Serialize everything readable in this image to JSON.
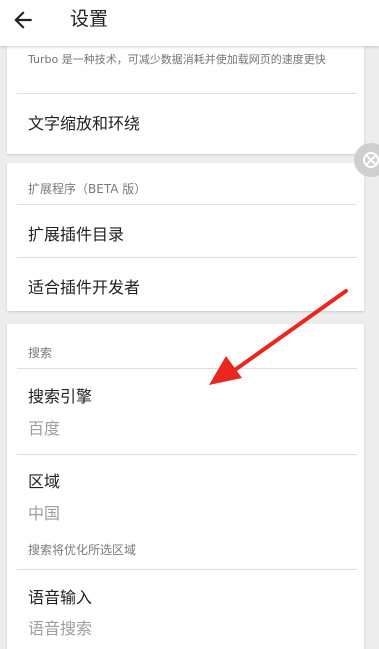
{
  "header": {
    "title": "设置",
    "back_icon": "arrow-left-icon"
  },
  "turbo_card": {
    "description": "Turbo 是一种技术，可减少数据消耗并使加载网页的速度更快",
    "text_scaling_label": "文字缩放和环绕"
  },
  "extensions_card": {
    "section_title": "扩展程序（BETA 版）",
    "catalog_label": "扩展插件目录",
    "developer_label": "适合插件开发者"
  },
  "search_card": {
    "section_title": "搜索",
    "engine_label": "搜索引擎",
    "engine_value": "百度",
    "region_label": "区域",
    "region_value": "中国",
    "region_note": "搜索将优化所选区域",
    "voice_label": "语音输入",
    "voice_value": "语音搜索"
  },
  "colors": {
    "annotation_arrow": "#e8271f",
    "background": "#ededed",
    "card": "#ffffff"
  }
}
